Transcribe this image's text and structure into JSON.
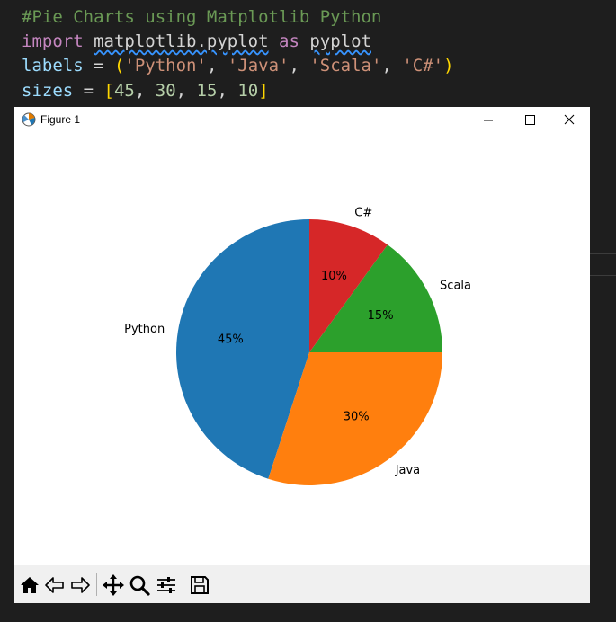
{
  "editor": {
    "line0": "                                         ",
    "line1": "#Pie Charts using Matplotlib Python",
    "line2": {
      "kw": "import",
      "mod": "matplotlib.pyplot",
      "as": "as",
      "alias": "pyplot"
    },
    "line3": {
      "var": "labels",
      "eq": " = ",
      "open": "(",
      "s1": "'Python'",
      "s2": "'Java'",
      "s3": "'Scala'",
      "s4": "'C#'",
      "comma": ", ",
      "close": ")"
    },
    "line4": {
      "var": "sizes",
      "eq": " = ",
      "open": "[",
      "n1": "45",
      "n2": "30",
      "n3": "15",
      "n4": "10",
      "comma": ", ",
      "close": "]"
    }
  },
  "window": {
    "title": "Figure 1",
    "minimize_icon": "minimize-icon",
    "maximize_icon": "maximize-icon",
    "close_icon": "close-icon"
  },
  "toolbar": {
    "tools": [
      "home-icon",
      "back-icon",
      "forward-icon",
      "pan-icon",
      "zoom-icon",
      "configure-subplots-icon",
      "save-icon"
    ]
  },
  "chart_data": {
    "type": "pie",
    "categories": [
      "Python",
      "Java",
      "Scala",
      "C#"
    ],
    "values": [
      45,
      30,
      15,
      10
    ],
    "value_labels": [
      "45%",
      "30%",
      "15%",
      "10%"
    ],
    "colors": [
      "#1f77b4",
      "#ff7f0e",
      "#2ca02c",
      "#d62728"
    ],
    "start_angle": 90,
    "direction": "counterclockwise",
    "title": ""
  }
}
